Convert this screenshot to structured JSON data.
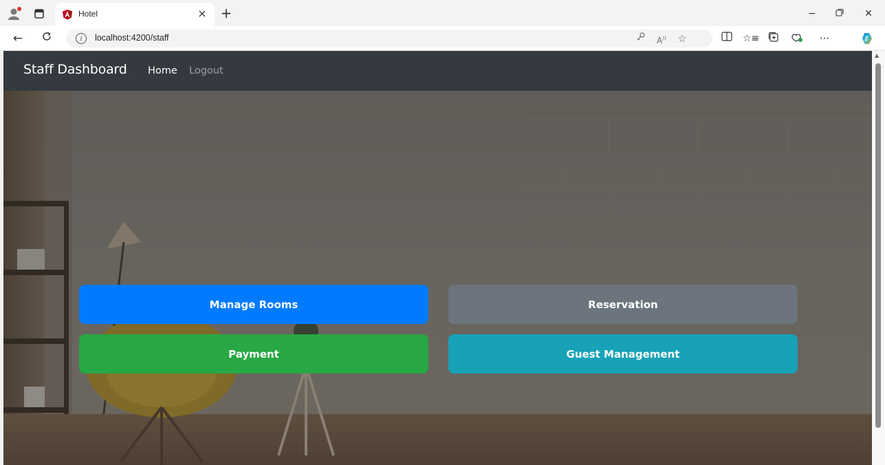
{
  "browser": {
    "tab_title": "Hotel",
    "url": "localhost:4200/staff",
    "icons": {
      "profile": "profile-icon",
      "workspaces": "workspaces-icon",
      "favicon": "angular-logo-icon",
      "close": "close-icon",
      "new_tab": "plus-icon",
      "back": "back-arrow-icon",
      "refresh": "refresh-icon",
      "info": "info-icon",
      "key": "key-icon",
      "read_aloud": "read-aloud-icon",
      "favorite": "star-icon",
      "split": "split-screen-icon",
      "favorites": "favorites-list-icon",
      "collections": "collections-icon",
      "performance": "performance-icon",
      "more": "more-icon",
      "copilot": "copilot-icon"
    }
  },
  "navbar": {
    "brand": "Staff Dashboard",
    "links": [
      {
        "label": "Home",
        "active": true
      },
      {
        "label": "Logout",
        "active": false
      }
    ]
  },
  "actions": [
    {
      "label": "Manage Rooms",
      "color": "#007bff"
    },
    {
      "label": "Reservation",
      "color": "#6c757d"
    },
    {
      "label": "Payment",
      "color": "#28a745"
    },
    {
      "label": "Guest Management",
      "color": "#17a2b8"
    }
  ]
}
